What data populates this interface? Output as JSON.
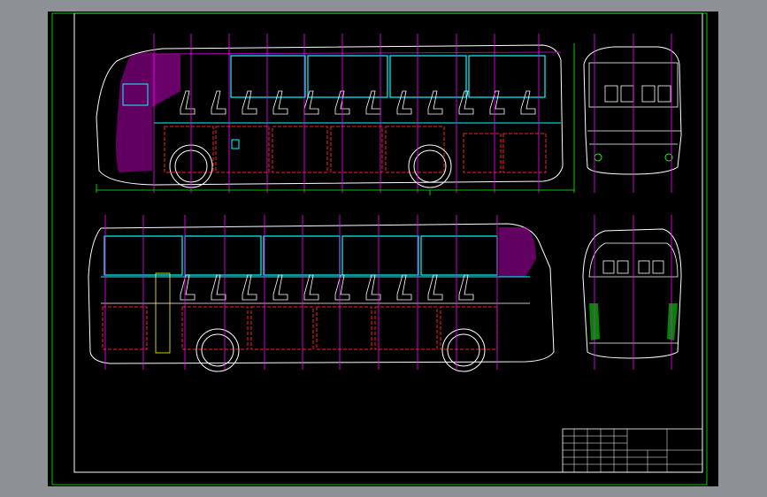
{
  "colors": {
    "background": "#000000",
    "frame": "#00ff00",
    "body_outline": "#ffffff",
    "structure": "#ff2020",
    "window_frame": "#00ffff",
    "center_line": "#ff00ff",
    "hatch": "#b000b0",
    "seat": "#ffffff",
    "dimension": "#00ff00",
    "light": "#ffff00"
  },
  "icons": {
    "front_wheel": "wheel-icon",
    "rear_wheel": "wheel-icon",
    "seat": "seat-icon"
  },
  "title_block": {
    "drawing_title": "",
    "drawing_code": ""
  }
}
